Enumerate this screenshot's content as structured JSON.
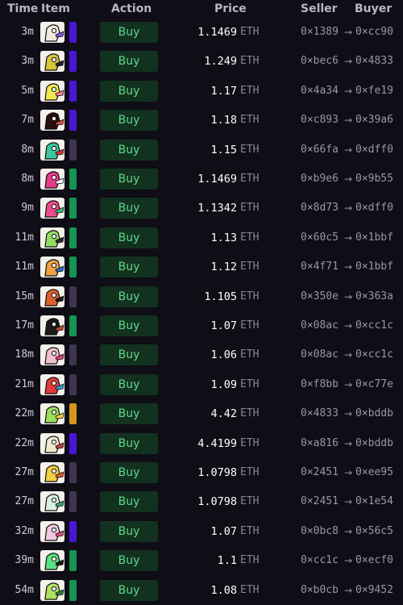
{
  "colors": {
    "background": "#0f0d16",
    "buy_bg": "#12321f",
    "buy_text": "#5ed98a",
    "rarity": {
      "indigo": "#4a15d8",
      "slate": "#3f3550",
      "green": "#129651",
      "orange": "#d6951a"
    }
  },
  "header": {
    "time": "Time",
    "item": "Item",
    "action": "Action",
    "price": "Price",
    "seller": "Seller",
    "buyer": "Buyer"
  },
  "rows": [
    {
      "time": "3m",
      "price": "1.1469",
      "unit": "ETH",
      "seller": "0×1389",
      "buyer": "0×cc90",
      "rarity": "indigo",
      "thumb": "#f2e9dc",
      "accent": "#7b5bd9",
      "action": "Buy"
    },
    {
      "time": "3m",
      "price": "1.249",
      "unit": "ETH",
      "seller": "0×bec6",
      "buyer": "0×4833",
      "rarity": "indigo",
      "thumb": "#d9c43a",
      "accent": "#222222",
      "action": "Buy"
    },
    {
      "time": "5m",
      "price": "1.17",
      "unit": "ETH",
      "seller": "0×4a34",
      "buyer": "0×fe19",
      "rarity": "indigo",
      "thumb": "#f2e94a",
      "accent": "#f07aa0",
      "action": "Buy"
    },
    {
      "time": "7m",
      "price": "1.18",
      "unit": "ETH",
      "seller": "0×c893",
      "buyer": "0×39a6",
      "rarity": "indigo",
      "thumb": "#2a0d0d",
      "accent": "#d84a4a",
      "action": "Buy"
    },
    {
      "time": "8m",
      "price": "1.15",
      "unit": "ETH",
      "seller": "0×66fa",
      "buyer": "0×dff0",
      "rarity": "slate",
      "thumb": "#3bc6a0",
      "accent": "#d03a3a",
      "action": "Buy"
    },
    {
      "time": "8m",
      "price": "1.1469",
      "unit": "ETH",
      "seller": "0×b9e6",
      "buyer": "0×9b55",
      "rarity": "green",
      "thumb": "#e83c8a",
      "accent": "#ffffff",
      "action": "Buy"
    },
    {
      "time": "9m",
      "price": "1.1342",
      "unit": "ETH",
      "seller": "0×8d73",
      "buyer": "0×dff0",
      "rarity": "green",
      "thumb": "#f04a90",
      "accent": "#3cc070",
      "action": "Buy"
    },
    {
      "time": "11m",
      "price": "1.13",
      "unit": "ETH",
      "seller": "0×60c5",
      "buyer": "0×1bbf",
      "rarity": "green",
      "thumb": "#8fe060",
      "accent": "#2a2a2a",
      "action": "Buy"
    },
    {
      "time": "11m",
      "price": "1.12",
      "unit": "ETH",
      "seller": "0×4f71",
      "buyer": "0×1bbf",
      "rarity": "green",
      "thumb": "#f0a040",
      "accent": "#2a6ad0",
      "action": "Buy"
    },
    {
      "time": "15m",
      "price": "1.105",
      "unit": "ETH",
      "seller": "0×350e",
      "buyer": "0×363a",
      "rarity": "slate",
      "thumb": "#d8602a",
      "accent": "#1a1a1a",
      "action": "Buy"
    },
    {
      "time": "17m",
      "price": "1.07",
      "unit": "ETH",
      "seller": "0×08ac",
      "buyer": "0×cc1c",
      "rarity": "green",
      "thumb": "#1a1a1a",
      "accent": "#c04a2a",
      "action": "Buy"
    },
    {
      "time": "18m",
      "price": "1.06",
      "unit": "ETH",
      "seller": "0×08ac",
      "buyer": "0×cc1c",
      "rarity": "slate",
      "thumb": "#f0c0d0",
      "accent": "#e03a70",
      "action": "Buy"
    },
    {
      "time": "21m",
      "price": "1.09",
      "unit": "ETH",
      "seller": "0×f8bb",
      "buyer": "0×c77e",
      "rarity": "slate",
      "thumb": "#e03a3a",
      "accent": "#2aa0d0",
      "action": "Buy"
    },
    {
      "time": "22m",
      "price": "4.42",
      "unit": "ETH",
      "seller": "0×4833",
      "buyer": "0×bddb",
      "rarity": "orange",
      "thumb": "#9ae05a",
      "accent": "#f0d040",
      "action": "Buy"
    },
    {
      "time": "22m",
      "price": "4.4199",
      "unit": "ETH",
      "seller": "0×a816",
      "buyer": "0×bddb",
      "rarity": "indigo",
      "thumb": "#f0e8d0",
      "accent": "#c03a3a",
      "action": "Buy"
    },
    {
      "time": "27m",
      "price": "1.0798",
      "unit": "ETH",
      "seller": "0×2451",
      "buyer": "0×ee95",
      "rarity": "slate",
      "thumb": "#f0d040",
      "accent": "#e05a2a",
      "action": "Buy"
    },
    {
      "time": "27m",
      "price": "1.0798",
      "unit": "ETH",
      "seller": "0×2451",
      "buyer": "0×1e54",
      "rarity": "slate",
      "thumb": "#d8f0e0",
      "accent": "#3aa070",
      "action": "Buy"
    },
    {
      "time": "32m",
      "price": "1.07",
      "unit": "ETH",
      "seller": "0×0bc8",
      "buyer": "0×56c5",
      "rarity": "indigo",
      "thumb": "#f0c8e0",
      "accent": "#e04a80",
      "action": "Buy"
    },
    {
      "time": "39m",
      "price": "1.1",
      "unit": "ETH",
      "seller": "0×cc1c",
      "buyer": "0×ecf0",
      "rarity": "green",
      "thumb": "#5ae080",
      "accent": "#1a1a1a",
      "action": "Buy"
    },
    {
      "time": "54m",
      "price": "1.08",
      "unit": "ETH",
      "seller": "0×b0cb",
      "buyer": "0×9452",
      "rarity": "green",
      "thumb": "#b0e060",
      "accent": "#2a7a3a",
      "action": "Buy"
    }
  ]
}
